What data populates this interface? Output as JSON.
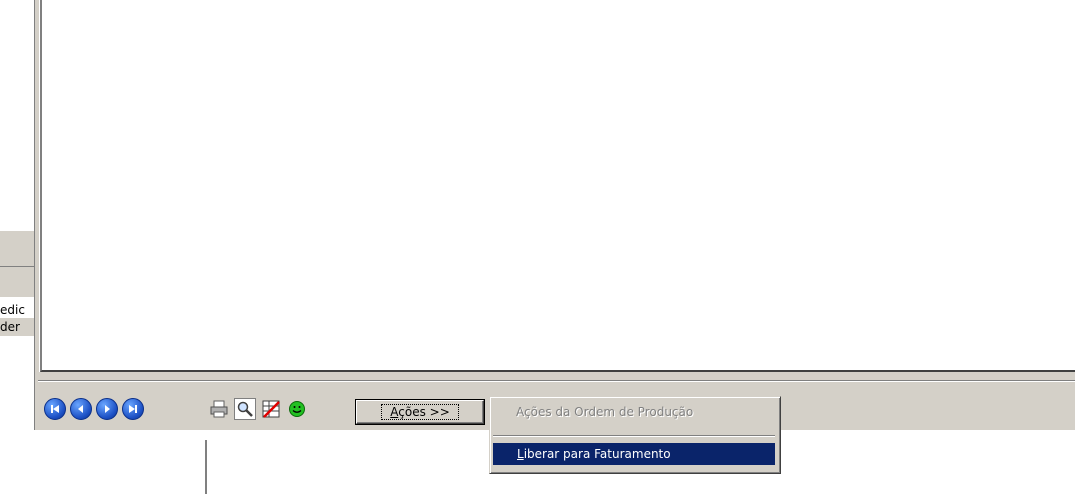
{
  "left_panel": {
    "text_line1": "edic",
    "text_line2": "der"
  },
  "toolbar": {
    "nav_buttons": [
      {
        "name": "first-record",
        "icon": "skip-back-icon"
      },
      {
        "name": "previous-record",
        "icon": "chevron-left-icon"
      },
      {
        "name": "next-record",
        "icon": "chevron-right-icon"
      },
      {
        "name": "last-record",
        "icon": "skip-forward-icon"
      }
    ],
    "tools": [
      {
        "name": "print",
        "icon": "printer-icon"
      },
      {
        "name": "search",
        "icon": "magnifier-icon"
      },
      {
        "name": "no-edit",
        "icon": "table-edit-disabled-icon"
      },
      {
        "name": "status",
        "icon": "smiley-icon"
      }
    ],
    "acoes_label": "Ações >>",
    "acoes_accel": "A"
  },
  "menu": {
    "title": "Ações da Ordem de Produção",
    "items": [
      {
        "label_accel": "L",
        "label_rest": "iberar para Faturamento"
      }
    ]
  },
  "colors": {
    "face": "#d4d0c8",
    "highlight": "#0a246a",
    "nav_blue": "#1e52c6"
  }
}
